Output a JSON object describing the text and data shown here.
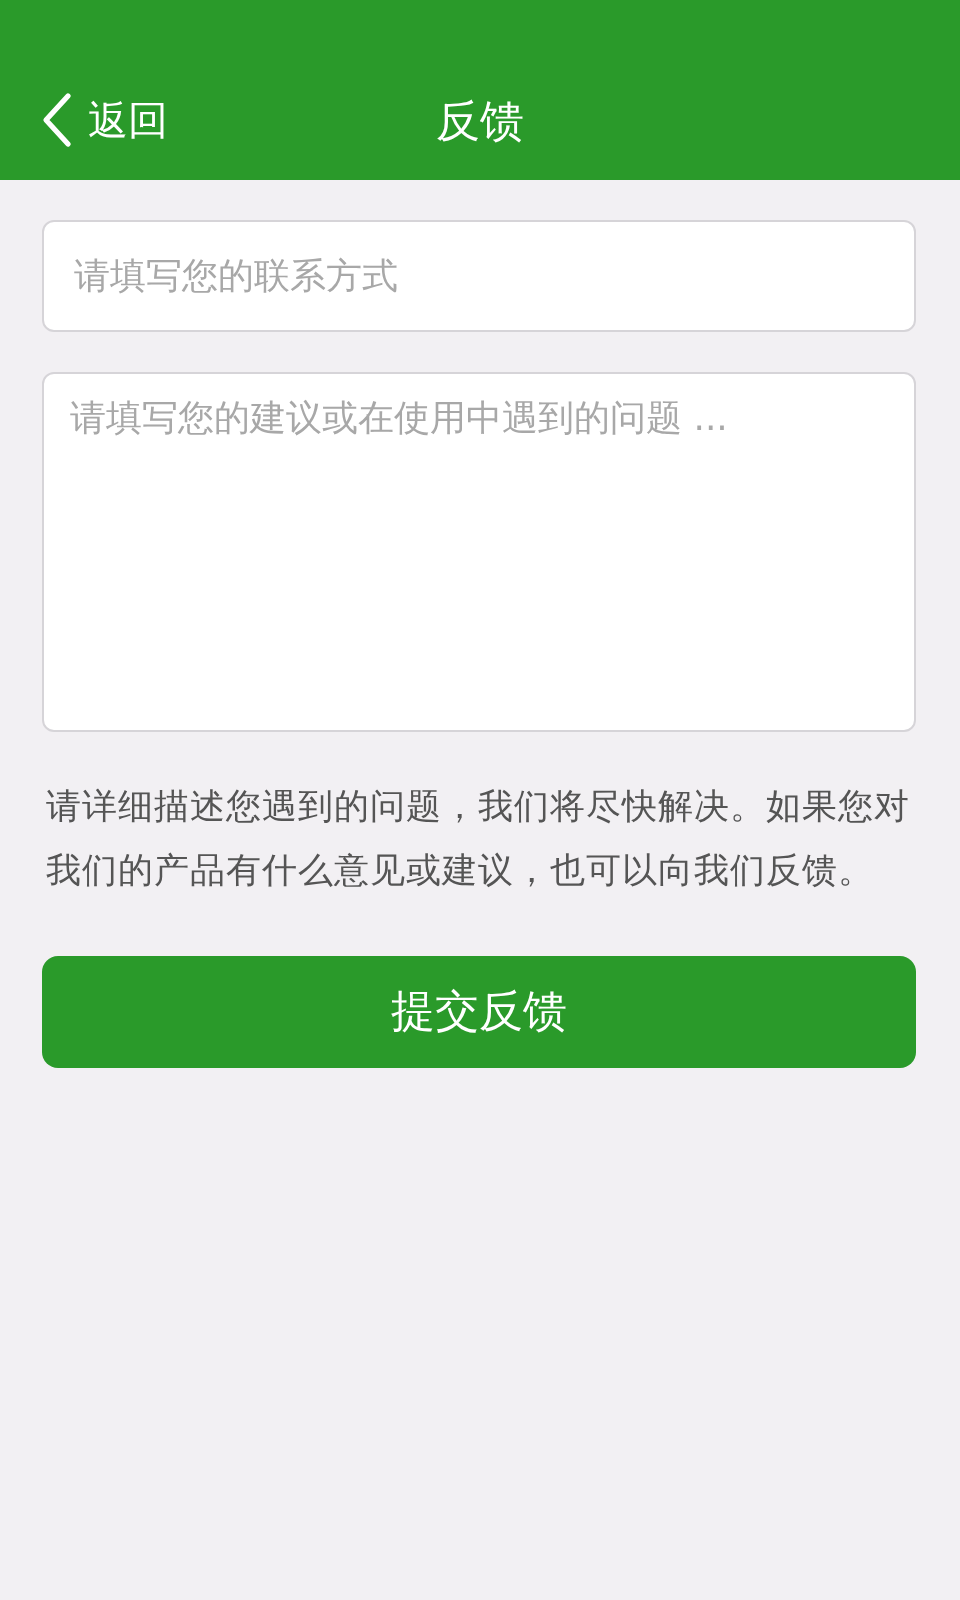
{
  "header": {
    "back_label": "返回",
    "title": "反馈"
  },
  "contact_field": {
    "placeholder": "请填写您的联系方式"
  },
  "feedback_field": {
    "placeholder": "请填写您的建议或在使用中遇到的问题 ..."
  },
  "hint": "请详细描述您遇到的问题，我们将尽快解决。如果您对我们的产品有什么意见或建议，也可以向我们反馈。",
  "submit_button": "提交反馈"
}
